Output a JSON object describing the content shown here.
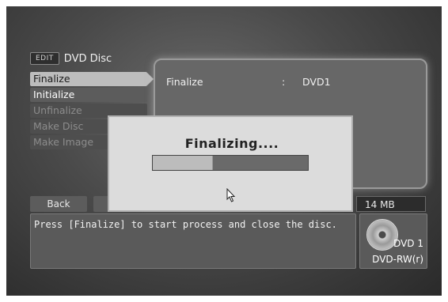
{
  "header": {
    "badge": "EDIT",
    "title": "DVD Disc"
  },
  "menu": {
    "items": [
      {
        "label": "Finalize",
        "state": "selected"
      },
      {
        "label": "Initialize",
        "state": "normal"
      },
      {
        "label": "Unfinalize",
        "state": "disabled"
      },
      {
        "label": "Make Disc",
        "state": "disabled"
      },
      {
        "label": "Make Image",
        "state": "disabled"
      }
    ]
  },
  "detail": {
    "label": "Finalize",
    "separator": ":",
    "value": "DVD1"
  },
  "footer": {
    "back_label": "Back",
    "size": "14 MB"
  },
  "message": "Press [Finalize] to start process and close the disc.",
  "disc": {
    "number": "DVD 1",
    "type": "DVD-RW(r)",
    "icon": "dvd-disc-icon"
  },
  "dialog": {
    "title": "Finalizing....",
    "progress": 0.39
  },
  "colors": {
    "selected_bg": "#bdbdbd",
    "panel_bg": "#676767",
    "dialog_bg": "#dcdcdc"
  }
}
